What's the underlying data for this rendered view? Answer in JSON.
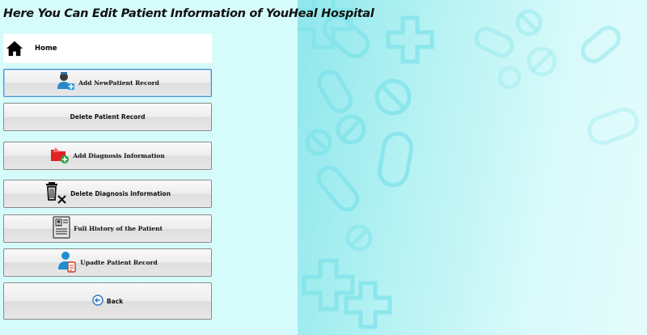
{
  "header": {
    "title": "Here You Can Edit Patient Information of YouHeal Hospital"
  },
  "nav": {
    "home_label": "Home"
  },
  "menu": {
    "items": [
      {
        "id": "add-new-patient-record",
        "label": "Add NewPatient Record",
        "icon": "doctor-add-icon"
      },
      {
        "id": "delete-patient-record",
        "label": "Delete Patient Record",
        "icon": ""
      },
      {
        "id": "add-diagnosis-information",
        "label": "Add Diagnosis Information",
        "icon": "red-folder-add-icon"
      },
      {
        "id": "delete-diagnosis-information",
        "label": "Delete Diagnosis Information",
        "icon": "trash-delete-icon"
      },
      {
        "id": "full-history",
        "label": "Full History of the Patient",
        "icon": "patient-card-icon"
      },
      {
        "id": "update-patient-record",
        "label": "Upadte Patient Record",
        "icon": "user-edit-icon"
      },
      {
        "id": "back",
        "label": "Back",
        "icon": "back-arrow-icon"
      }
    ]
  },
  "colors": {
    "accent": "#1f8ecf",
    "panel_bg": "#d6fbfb",
    "pattern_stroke": "#7fe3ea"
  }
}
